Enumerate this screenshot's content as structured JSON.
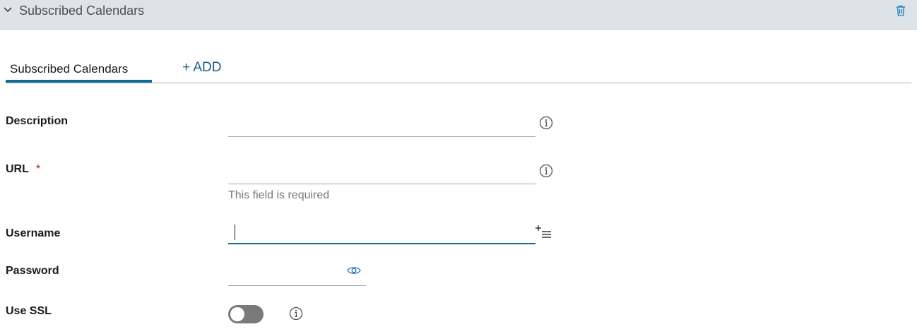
{
  "header": {
    "title": "Subscribed Calendars",
    "collapse_icon": "chevron-down-icon",
    "delete_icon": "trash-icon"
  },
  "tabs": {
    "active_label": "Subscribed Calendars",
    "add_label": "+ ADD"
  },
  "form": {
    "description": {
      "label": "Description",
      "value": ""
    },
    "url": {
      "label": "URL",
      "required_mark": "*",
      "value": "",
      "error": "This field is required"
    },
    "username": {
      "label": "Username",
      "value": ""
    },
    "password": {
      "label": "Password",
      "value": ""
    },
    "use_ssl": {
      "label": "Use SSL",
      "on": false
    }
  },
  "colors": {
    "accent": "#0f6e97",
    "header_bg": "#dce4ea",
    "required": "#c21d00",
    "toggle_off": "#7a7a7a"
  }
}
